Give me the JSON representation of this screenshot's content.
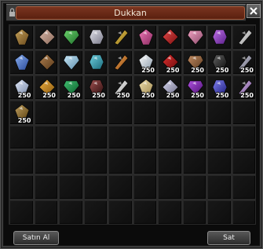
{
  "window": {
    "title": "Dukkan"
  },
  "actions": {
    "buy_label": "Satın Al",
    "sell_label": "Sat"
  },
  "inventory": {
    "slots_total": 80,
    "items": [
      {
        "name": "stick-item",
        "qty": "",
        "colors": [
          "#c7a35a",
          "#6b4a1d"
        ]
      },
      {
        "name": "shell-item",
        "qty": "",
        "colors": [
          "#d9b6a8",
          "#8a6a5a"
        ]
      },
      {
        "name": "green-gem-item",
        "qty": "",
        "colors": [
          "#6ad36a",
          "#1d6a2a"
        ]
      },
      {
        "name": "silver-crystal-item",
        "qty": "",
        "colors": [
          "#e0e0e8",
          "#7a7a8a"
        ]
      },
      {
        "name": "gold-gem-item",
        "qty": "",
        "colors": [
          "#e8c858",
          "#8a6a10"
        ]
      },
      {
        "name": "pink-gem-item",
        "qty": "",
        "colors": [
          "#f07ab8",
          "#8a2a60"
        ]
      },
      {
        "name": "red-gem-item",
        "qty": "",
        "colors": [
          "#e84a4a",
          "#7a1010"
        ]
      },
      {
        "name": "rose-crystal-item",
        "qty": "",
        "colors": [
          "#f0a0c0",
          "#8a4a6a"
        ]
      },
      {
        "name": "violet-gem-item",
        "qty": "",
        "colors": [
          "#c070e8",
          "#5a208a"
        ]
      },
      {
        "name": "white-crystal-item",
        "qty": "",
        "colors": [
          "#f0f0f0",
          "#909090"
        ]
      },
      {
        "name": "blue-shard-item",
        "qty": "",
        "colors": [
          "#8ab0f0",
          "#2a4a9a"
        ]
      },
      {
        "name": "brown-stone-item",
        "qty": "",
        "colors": [
          "#b08050",
          "#5a3a1a"
        ]
      },
      {
        "name": "ice-shard-item",
        "qty": "",
        "colors": [
          "#c8e8f8",
          "#5a8aa8"
        ]
      },
      {
        "name": "cyan-gem-item",
        "qty": "",
        "colors": [
          "#70d0e0",
          "#1a6a7a"
        ]
      },
      {
        "name": "orange-gem-item",
        "qty": "",
        "colors": [
          "#f0a050",
          "#8a4a10"
        ]
      },
      {
        "name": "diamond-item",
        "qty": "250",
        "colors": [
          "#ffffff",
          "#8a9aaa"
        ]
      },
      {
        "name": "ruby-item",
        "qty": "250",
        "colors": [
          "#e03030",
          "#6a0a0a"
        ]
      },
      {
        "name": "pearl-brown-item",
        "qty": "250",
        "colors": [
          "#c08a60",
          "#5a3a20"
        ]
      },
      {
        "name": "black-gem-item",
        "qty": "250",
        "colors": [
          "#606060",
          "#101010"
        ]
      },
      {
        "name": "silver-gem-item",
        "qty": "250",
        "colors": [
          "#d0d0e0",
          "#606070"
        ]
      },
      {
        "name": "crystal-cluster-item",
        "qty": "250",
        "colors": [
          "#e0e8f8",
          "#7a8aa8"
        ]
      },
      {
        "name": "amber-item",
        "qty": "250",
        "colors": [
          "#f0b040",
          "#8a5a10"
        ]
      },
      {
        "name": "jade-item",
        "qty": "250",
        "colors": [
          "#40c070",
          "#0a5a2a"
        ]
      },
      {
        "name": "dark-pearl-item",
        "qty": "250",
        "colors": [
          "#a05050",
          "#301010"
        ]
      },
      {
        "name": "white-pearl-item",
        "qty": "250",
        "colors": [
          "#f8f8f8",
          "#a0a0a0"
        ]
      },
      {
        "name": "topaz-item",
        "qty": "250",
        "colors": [
          "#f0e0b0",
          "#a08a50"
        ]
      },
      {
        "name": "quartz-item",
        "qty": "250",
        "colors": [
          "#d8d8f0",
          "#70708a"
        ]
      },
      {
        "name": "amethyst-item",
        "qty": "250",
        "colors": [
          "#b050e0",
          "#4a1070"
        ]
      },
      {
        "name": "sapphire-item",
        "qty": "250",
        "colors": [
          "#8080f0",
          "#202080"
        ]
      },
      {
        "name": "opal-item",
        "qty": "250",
        "colors": [
          "#e0c0f0",
          "#6a4a8a"
        ]
      },
      {
        "name": "sword-item",
        "qty": "250",
        "colors": [
          "#c0a060",
          "#5a4010"
        ]
      }
    ]
  }
}
